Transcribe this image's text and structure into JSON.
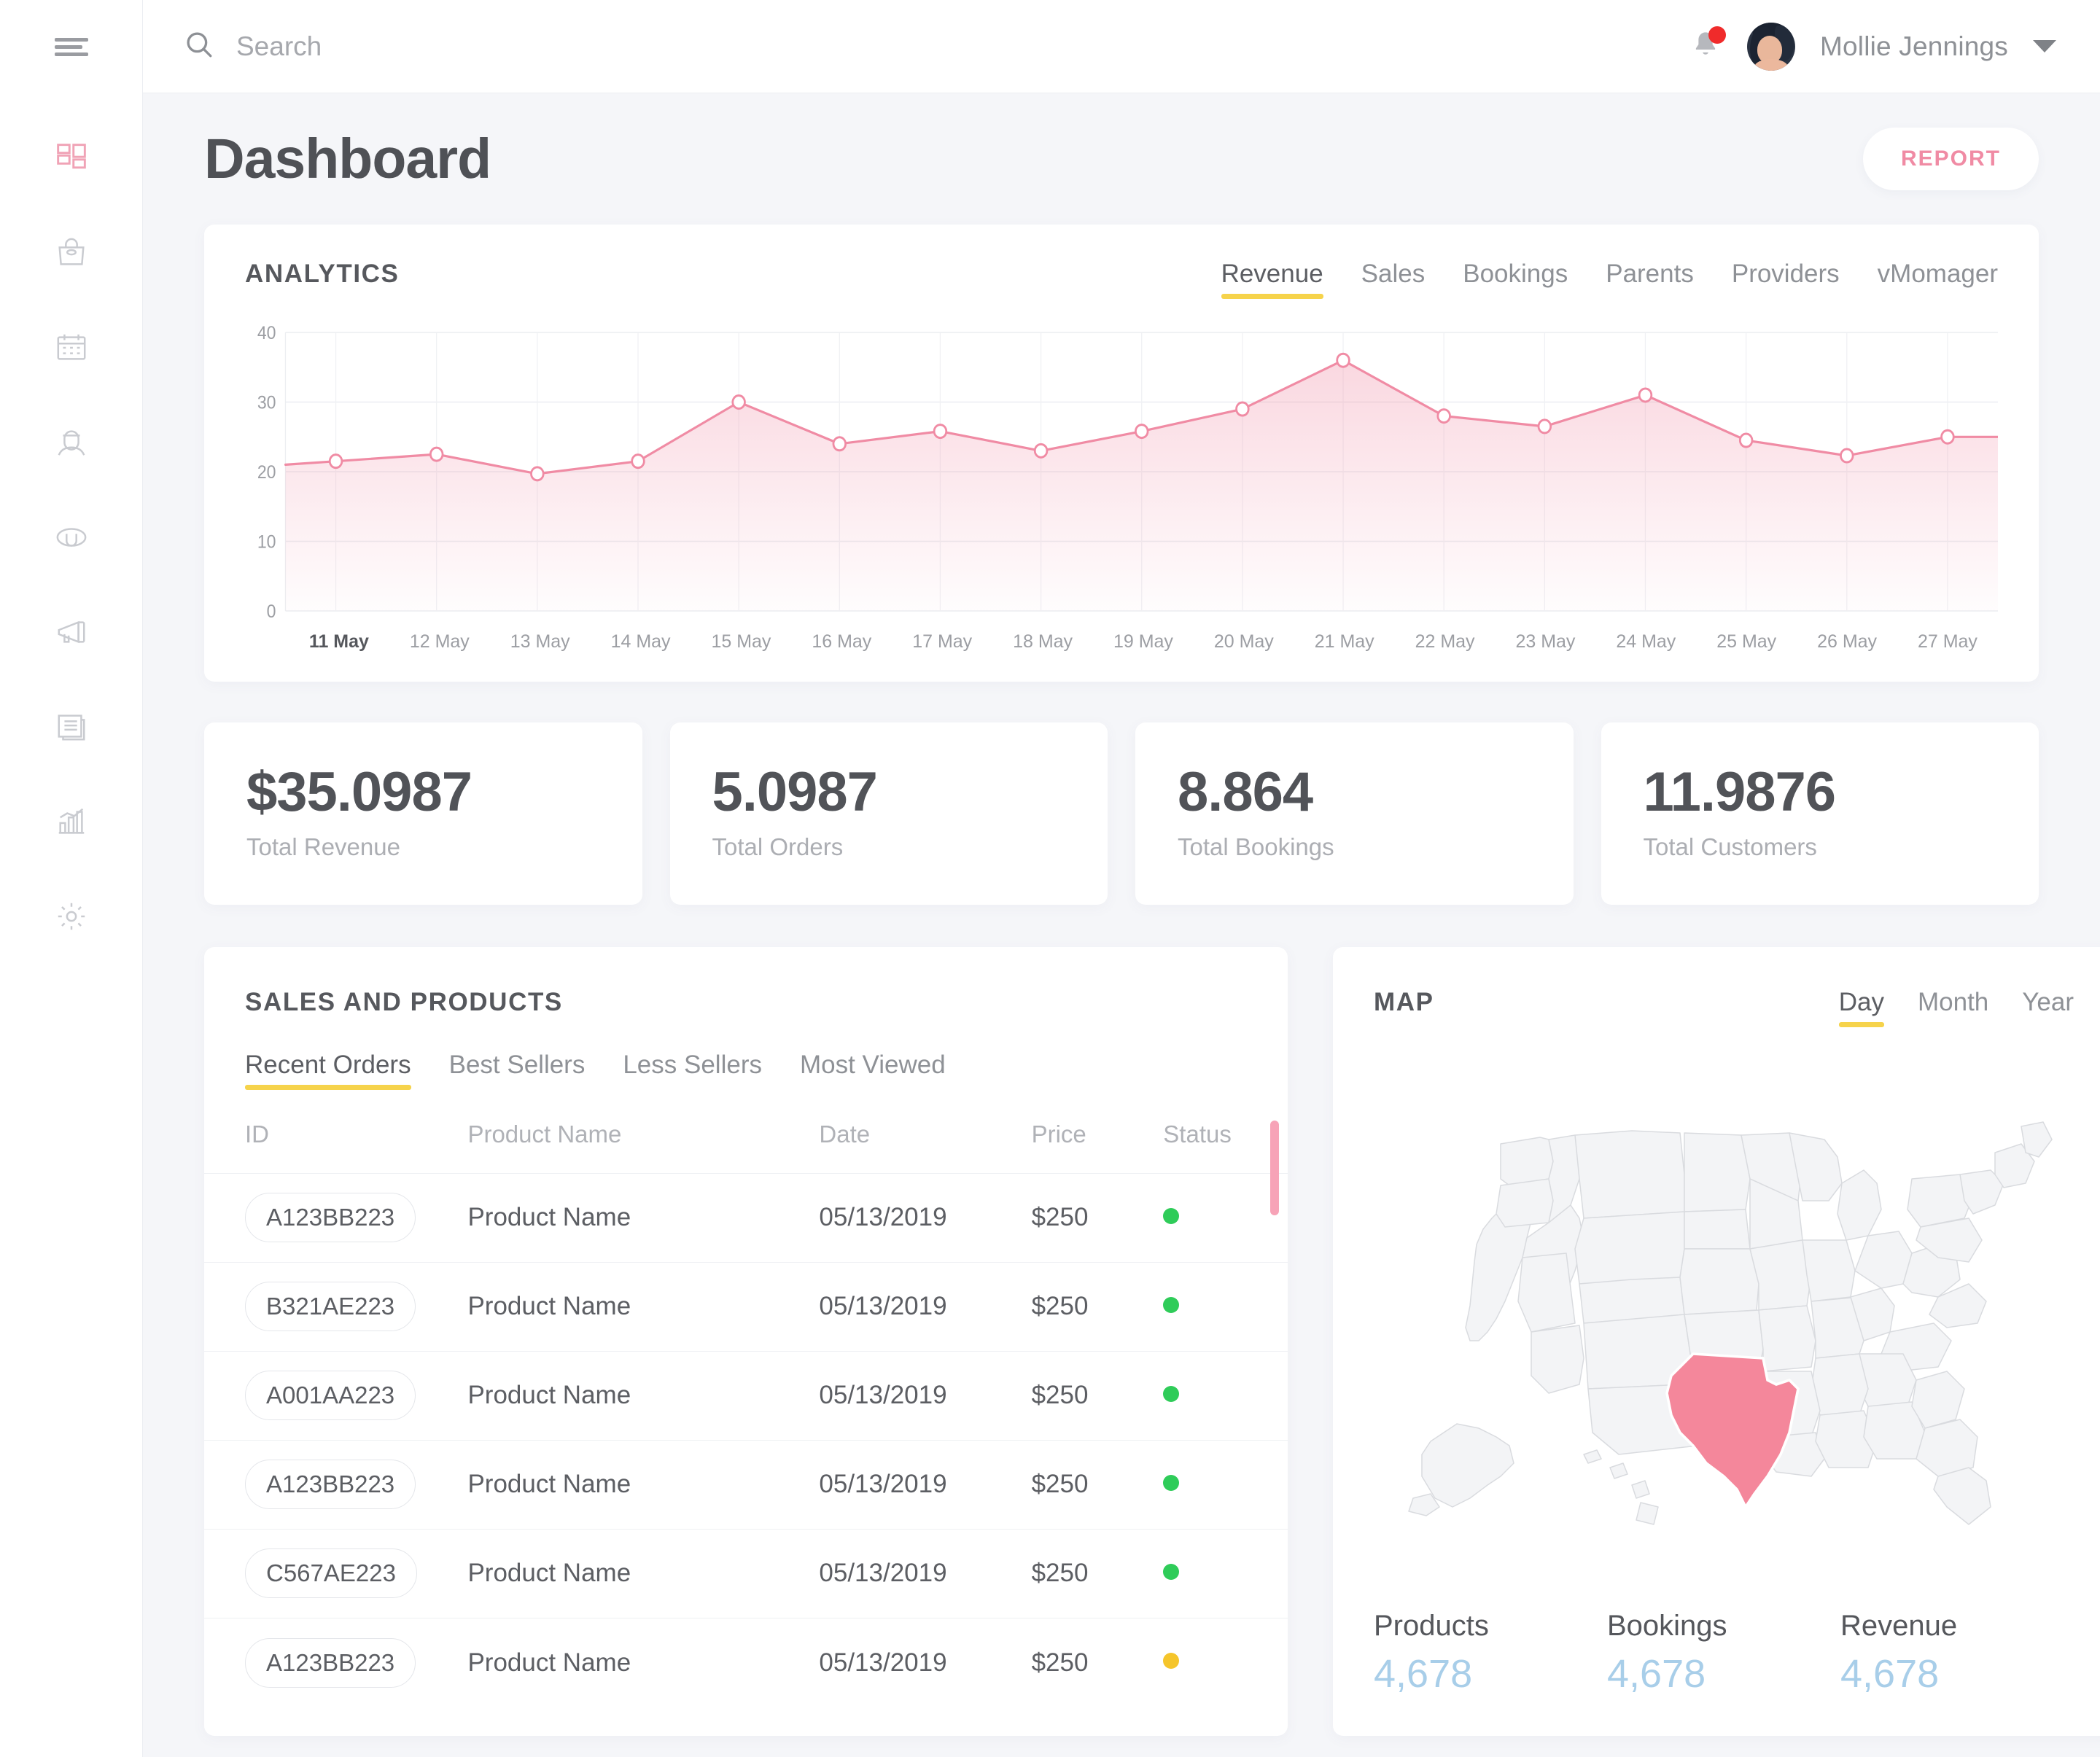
{
  "topbar": {
    "menu_icon": "hamburger-icon",
    "search_placeholder": "Search",
    "search_value": "",
    "search_icon": "search-icon",
    "notification_icon": "bell-icon",
    "has_notification": true,
    "username": "Mollie Jennings",
    "caret_icon": "chevron-down-icon"
  },
  "sidebar": {
    "items": [
      {
        "icon": "dashboard-grid-icon",
        "active": true
      },
      {
        "icon": "shopping-bag-icon",
        "active": false
      },
      {
        "icon": "calendar-icon",
        "active": false
      },
      {
        "icon": "user-profile-icon",
        "active": false
      },
      {
        "icon": "headset-support-icon",
        "active": false
      },
      {
        "icon": "megaphone-icon",
        "active": false
      },
      {
        "icon": "documents-icon",
        "active": false
      },
      {
        "icon": "bar-chart-icon",
        "active": false
      },
      {
        "icon": "gear-icon",
        "active": false
      }
    ]
  },
  "page": {
    "title": "Dashboard",
    "report_label": "REPORT"
  },
  "analytics": {
    "title": "ANALYTICS",
    "tabs": [
      {
        "label": "Revenue",
        "active": true
      },
      {
        "label": "Sales",
        "active": false
      },
      {
        "label": "Bookings",
        "active": false
      },
      {
        "label": "Parents",
        "active": false
      },
      {
        "label": "Providers",
        "active": false
      },
      {
        "label": "vMomager",
        "active": false
      }
    ]
  },
  "chart_data": {
    "type": "area",
    "title": "ANALYTICS",
    "series_name": "Revenue",
    "xlabel": "",
    "ylabel": "",
    "ylim": [
      0,
      40
    ],
    "yticks": [
      0,
      10,
      20,
      30,
      40
    ],
    "grid": true,
    "legend": "none",
    "accent_color": "#f08ba4",
    "categories": [
      "11 May",
      "12 May",
      "13 May",
      "14 May",
      "15 May",
      "16 May",
      "17 May",
      "18 May",
      "19 May",
      "20 May",
      "21 May",
      "22 May",
      "23 May",
      "24 May",
      "25 May",
      "26 May",
      "27 May"
    ],
    "values": [
      21.5,
      22.5,
      19.7,
      21.5,
      30.0,
      24.0,
      25.8,
      23.0,
      25.8,
      29.0,
      36.0,
      28.0,
      26.5,
      31.0,
      24.5,
      22.3,
      25.0
    ]
  },
  "stats": [
    {
      "value": "$35.0987",
      "label": "Total Revenue"
    },
    {
      "value": "5.0987",
      "label": "Total Orders"
    },
    {
      "value": "8.864",
      "label": "Total Bookings"
    },
    {
      "value": "11.9876",
      "label": "Total Customers"
    }
  ],
  "sales": {
    "title": "SALES AND PRODUCTS",
    "tabs": [
      {
        "label": "Recent Orders",
        "active": true
      },
      {
        "label": "Best Sellers",
        "active": false
      },
      {
        "label": "Less Sellers",
        "active": false
      },
      {
        "label": "Most Viewed",
        "active": false
      }
    ],
    "columns": [
      "ID",
      "Product Name",
      "Date",
      "Price",
      "Status"
    ],
    "rows": [
      {
        "id": "A123BB223",
        "product": "Product Name",
        "date": "05/13/2019",
        "price": "$250",
        "status_color": "#2fcc59"
      },
      {
        "id": "B321AE223",
        "product": "Product Name",
        "date": "05/13/2019",
        "price": "$250",
        "status_color": "#2fcc59"
      },
      {
        "id": "A001AA223",
        "product": "Product Name",
        "date": "05/13/2019",
        "price": "$250",
        "status_color": "#2fcc59"
      },
      {
        "id": "A123BB223",
        "product": "Product Name",
        "date": "05/13/2019",
        "price": "$250",
        "status_color": "#2fcc59"
      },
      {
        "id": "C567AE223",
        "product": "Product Name",
        "date": "05/13/2019",
        "price": "$250",
        "status_color": "#2fcc59"
      },
      {
        "id": "A123BB223",
        "product": "Product Name",
        "date": "05/13/2019",
        "price": "$250",
        "status_color": "#f5c52b"
      }
    ]
  },
  "map": {
    "title": "MAP",
    "tabs": [
      {
        "label": "Day",
        "active": true
      },
      {
        "label": "Month",
        "active": false
      },
      {
        "label": "Year",
        "active": false
      }
    ],
    "highlighted_region": "Texas",
    "highlight_color": "#f4879b",
    "stats": [
      {
        "label": "Products",
        "value": "4,678"
      },
      {
        "label": "Bookings",
        "value": "4,678"
      },
      {
        "label": "Revenue",
        "value": "4,678"
      }
    ]
  },
  "colors": {
    "accent_pink": "#f08ba4",
    "accent_yellow": "#f6d34b",
    "status_green": "#2fcc59",
    "status_amber": "#f5c52b",
    "map_value_blue": "#a8cee9",
    "page_bg": "#f5f6f9"
  }
}
